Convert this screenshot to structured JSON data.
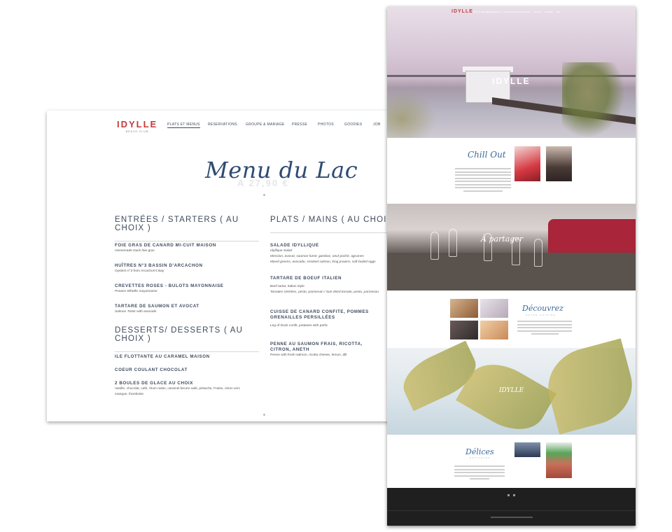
{
  "menu_page": {
    "logo": {
      "word": "IDYLLE",
      "tagline": "BEACH CLUB"
    },
    "nav": [
      "PLATS ET MENUS",
      "RESERVATIONS",
      "GROUPE & MARIAGE",
      "PRESSE",
      "PHOTOS",
      "GOODIES",
      "JOB"
    ],
    "title": "Menu du Lac",
    "price": "A 27,90 €",
    "starters": {
      "heading": "ENTRÉES / STARTERS ( AU CHOIX )",
      "items": [
        {
          "title": "FOIE GRAS DE CANARD MI-CUIT MAISON",
          "desc": [
            "Homemade Duck foie gras"
          ]
        },
        {
          "title": "HUÎTRES N°3 BASSIN D'ARCACHON",
          "desc": [
            "Oysters n°3 from Arcachon's Bay"
          ]
        },
        {
          "title": "CREVETTES ROSES - BULOTS MAYONNAISE",
          "desc": [
            "Prawns-Whelks mayonnaise"
          ]
        },
        {
          "title": "TARTARE DE SAUMON ET AVOCAT",
          "desc": [
            "Salmon Tartar with avocado"
          ]
        }
      ]
    },
    "desserts": {
      "heading": "DESSERTS/ DESSERTS ( AU CHOIX )",
      "items": [
        {
          "title": "ILE FLOTTANTE AU CARAMEL MAISON",
          "desc": []
        },
        {
          "title": "COEUR COULANT CHOCOLAT",
          "desc": []
        },
        {
          "title": "2 BOULES DE GLACE AU CHOIX",
          "desc": [
            "Vanille, chocolat, café, rhum raisin, caramel beurre salé, pistache, Fraise, citron vert,",
            "mangue, framboise"
          ]
        }
      ]
    },
    "mains": {
      "heading": "PLATS / MAINS ( AU CHOIX )",
      "items": [
        {
          "title": "SALADE IDYLLIQUE",
          "desc": [
            "Idyllique Salad",
            "Mesclun, avocat, saumon fumé, gambas, oeuf poché, agrumes",
            "Mixed greens, avocado, smoked salmon, king prawns, soft-boiled eggs"
          ]
        },
        {
          "title": "TARTARE DE BOEUF ITALIEN",
          "desc": [
            "Beef tartar, Italian style",
            "Tomates séchées, pesto, parmesan / Sun-dried tomato, pesto, parmesan"
          ]
        },
        {
          "title": "CUISSE DE CANARD CONFITE, POMMES GRENAILLES PERSILLÉES",
          "desc": [
            "Leg of Duck confit, potatoes with parlic"
          ]
        },
        {
          "title": "PENNE AU SAUMON FRAIS, RICOTTA, CITRON, ANETH",
          "desc": [
            "Penne with fresh salmon, ricotta cheese, lemon, dill"
          ]
        }
      ]
    }
  },
  "home_page": {
    "logo": "IDYLLE",
    "hero_logo": "IDYLLE",
    "sections": {
      "chill_out": "Chill Out",
      "partager": "À partager",
      "decouvrez": "Découvrez",
      "decouvrez_sub": "NOTRE CUISINE",
      "delices": "Délices",
      "delices_sub": "ESTIVALES",
      "band2_logo": "IDYLLE"
    }
  },
  "colors": {
    "brand_red": "#c43a3a",
    "navy": "#2f4b74",
    "text": "#3d4a5c"
  }
}
